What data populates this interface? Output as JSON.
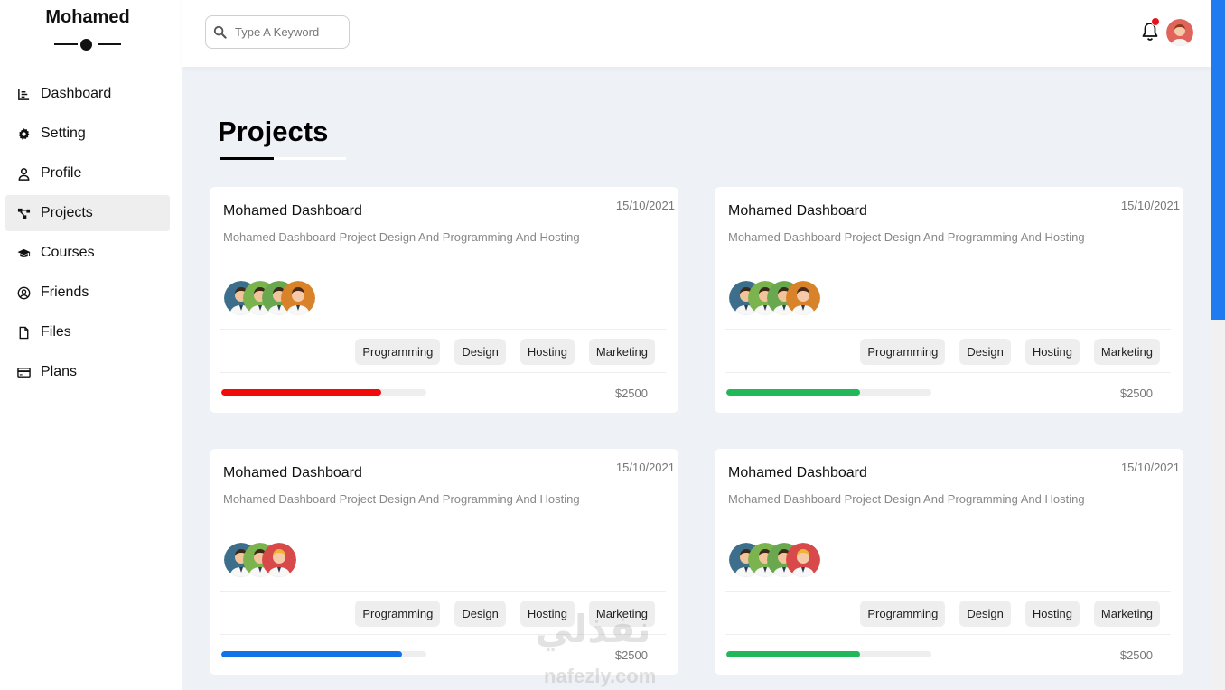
{
  "brand": {
    "name": "Mohamed"
  },
  "sidebar": {
    "items": [
      {
        "label": "Dashboard",
        "icon": "chart-icon",
        "active": false
      },
      {
        "label": "Setting",
        "icon": "gear-icon",
        "active": false
      },
      {
        "label": "Profile",
        "icon": "user-icon",
        "active": false
      },
      {
        "label": "Projects",
        "icon": "diagram-icon",
        "active": true
      },
      {
        "label": "Courses",
        "icon": "graduation-cap-icon",
        "active": false
      },
      {
        "label": "Friends",
        "icon": "user-circle-icon",
        "active": false
      },
      {
        "label": "Files",
        "icon": "file-icon",
        "active": false
      },
      {
        "label": "Plans",
        "icon": "credit-card-icon",
        "active": false
      }
    ]
  },
  "topbar": {
    "search_placeholder": "Type A Keyword",
    "notification_icon": "bell-icon",
    "notification_badge_color": "#e8101b"
  },
  "page": {
    "title": "Projects"
  },
  "cards": [
    {
      "name": "Mohamed Dashboard",
      "date": "15/10/2021",
      "description": "Mohamed Dashboard Project Design And Programming And Hosting",
      "team_count": 4,
      "tags": [
        "Programming",
        "Design",
        "Hosting",
        "Marketing"
      ],
      "progress": 0.78,
      "progress_color": "#f20b0b",
      "price": "$2500"
    },
    {
      "name": "Mohamed Dashboard",
      "date": "15/10/2021",
      "description": "Mohamed Dashboard Project Design And Programming And Hosting",
      "team_count": 4,
      "tags": [
        "Programming",
        "Design",
        "Hosting",
        "Marketing"
      ],
      "progress": 0.65,
      "progress_color": "#22b859",
      "price": "$2500"
    },
    {
      "name": "Mohamed Dashboard",
      "date": "15/10/2021",
      "description": "Mohamed Dashboard Project Design And Programming And Hosting",
      "team_count": 3,
      "tags": [
        "Programming",
        "Design",
        "Hosting",
        "Marketing"
      ],
      "progress": 0.88,
      "progress_color": "#1173e8",
      "price": "$2500"
    },
    {
      "name": "Mohamed Dashboard",
      "date": "15/10/2021",
      "description": "Mohamed Dashboard Project Design And Programming And Hosting",
      "team_count": 4,
      "tags": [
        "Programming",
        "Design",
        "Hosting",
        "Marketing"
      ],
      "progress": 0.65,
      "progress_color": "#22b859",
      "price": "$2500"
    }
  ],
  "watermark": {
    "arabic": "نفذلي",
    "latin": "nafezly.com"
  }
}
